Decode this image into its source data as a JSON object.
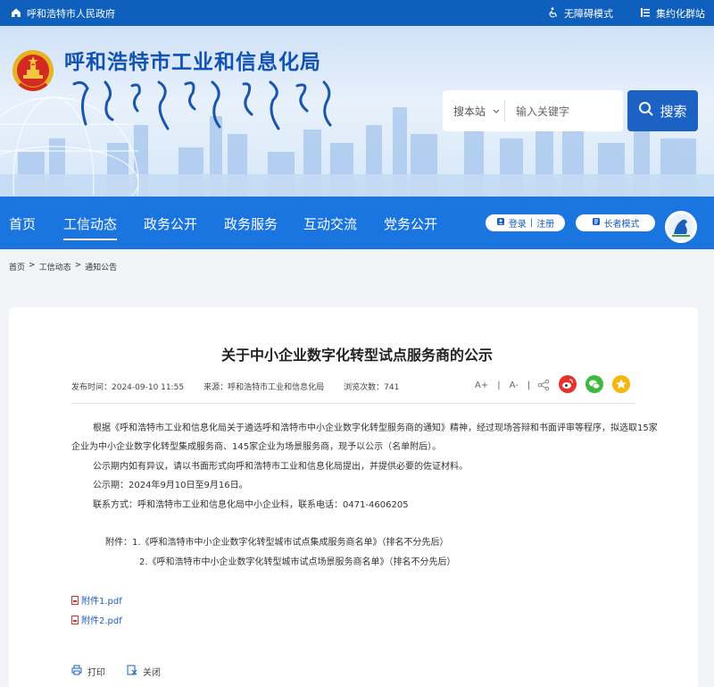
{
  "topbar": {
    "site_name": "呼和浩特市人民政府",
    "accessibility": "无障碍模式",
    "group": "集约化群站"
  },
  "header": {
    "title": "呼和浩特市工业和信息化局",
    "mongolian": "ᠬᠥᠬᠡᠬᠣᠲᠠ",
    "search_scope": "搜本站",
    "search_placeholder": "输入关键字",
    "search_button": "搜索"
  },
  "nav": {
    "items": [
      "首页",
      "工信动态",
      "政务公开",
      "政务服务",
      "互动交流",
      "党务公开"
    ],
    "active_index": 1,
    "login": "登录",
    "register": "注册",
    "elder_mode": "长者模式"
  },
  "breadcrumb": [
    "首页",
    "工信动态",
    "通知公告"
  ],
  "article": {
    "title": "关于中小企业数字化转型试点服务商的公示",
    "publish_time": "发布时间：2024-09-10 11:55",
    "source": "来源：呼和浩特市工业和信息化局",
    "views": "浏览次数：741",
    "font_larger": "A+",
    "font_smaller": "A-",
    "para1_line1": "根据《呼和浩特市工业和信息化局关于遴选呼和浩特市中小企业数字化转型服务商的通知》精神，经过现场答辩和书面评审等程序，拟选取15家",
    "para1_line2": "企业为中小企业数字化转型集成服务商、145家企业为场景服务商，现予以公示（名单附后）。",
    "para2": "公示期内如有异议，请以书面形式向呼和浩特市工业和信息化局提出，并提供必要的佐证材料。",
    "para3": "公示期：2024年9月10日至9月16日。",
    "para4": "联系方式：呼和浩特市工业和信息化局中小企业科，联系电话：0471-4606205",
    "annex1": "附件：1.《呼和浩特市中小企业数字化转型城市试点集成服务商名单》（排名不分先后）",
    "annex2": "2.《呼和浩特市中小企业数字化转型城市试点场景服务商名单》（排名不分先后）",
    "attachments": [
      "附件1.pdf",
      "附件2.pdf"
    ],
    "print": "打印",
    "close": "关闭"
  },
  "colors": {
    "topbar": "#0f5fbd",
    "nav": "#1a75e0",
    "title_blue": "#1252b3",
    "search_button": "#1c62c4"
  }
}
